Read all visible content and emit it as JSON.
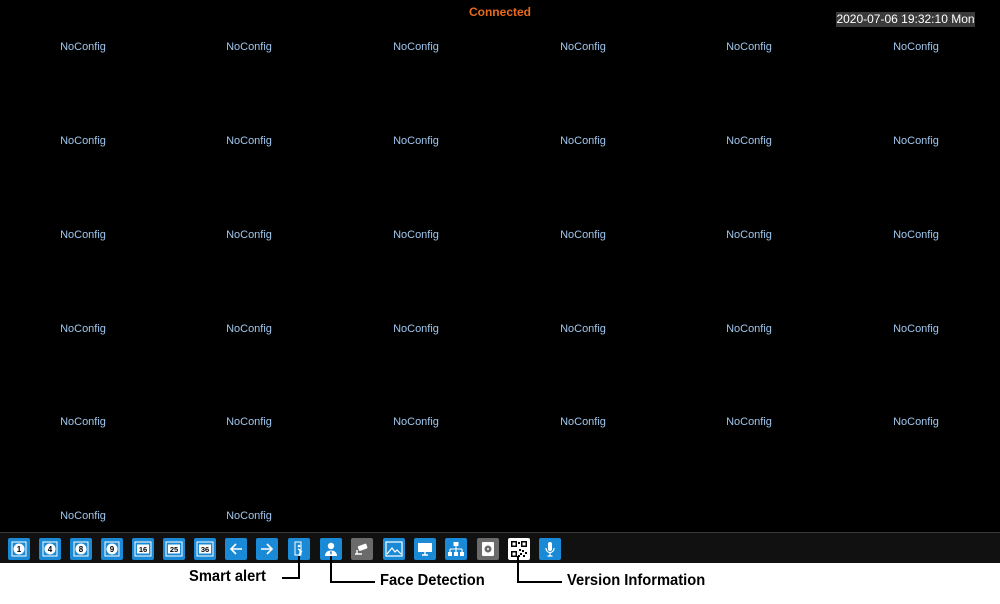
{
  "status": "Connected",
  "datetime": "2020-07-06 19:32:10 Mon",
  "channel_label": "NoConfig",
  "colors": {
    "status": "#e86a1c",
    "label": "#9fc6ee",
    "button": "#1a8ad6",
    "button_disabled": "#6b6b6b"
  },
  "toolbar": {
    "buttons": [
      {
        "icon": "layout-1-icon",
        "text": "1"
      },
      {
        "icon": "layout-4-icon",
        "text": "4"
      },
      {
        "icon": "layout-8-icon",
        "text": "8"
      },
      {
        "icon": "layout-9-icon",
        "text": "9"
      },
      {
        "icon": "layout-16-icon",
        "text": "16"
      },
      {
        "icon": "layout-25-icon",
        "text": "25"
      },
      {
        "icon": "layout-36-icon",
        "text": "36"
      },
      {
        "icon": "arrow-left-icon"
      },
      {
        "icon": "arrow-right-icon"
      },
      {
        "icon": "smart-alert-icon"
      },
      {
        "icon": "face-detection-icon"
      },
      {
        "icon": "ptz-camera-icon"
      },
      {
        "icon": "image-icon"
      },
      {
        "icon": "monitor-icon"
      },
      {
        "icon": "network-icon"
      },
      {
        "icon": "disk-icon"
      },
      {
        "icon": "qr-code-icon"
      },
      {
        "icon": "microphone-icon"
      }
    ]
  },
  "annotations": {
    "smart_alert": "Smart alert",
    "face_detection": "Face Detection",
    "version_information": "Version Information"
  }
}
